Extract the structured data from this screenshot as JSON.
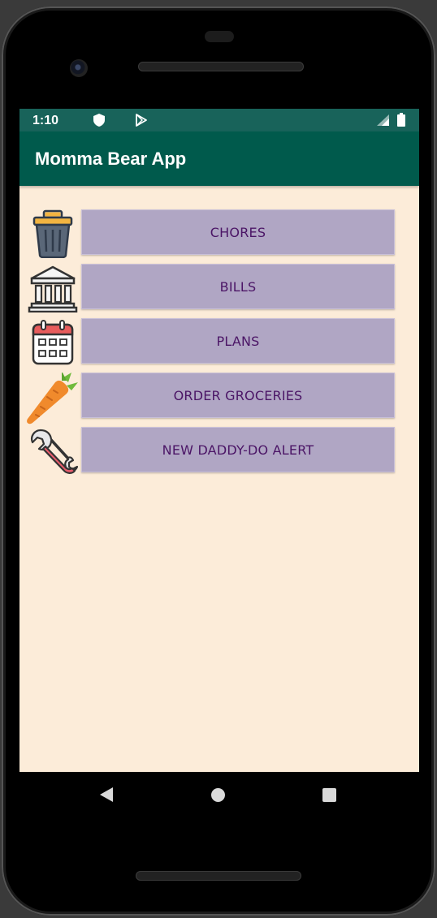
{
  "statusbar": {
    "time": "1:10",
    "icons": [
      "shield-icon",
      "play-store-icon",
      "signal-icon",
      "battery-icon"
    ]
  },
  "appbar": {
    "title": "Momma Bear App"
  },
  "menu": {
    "items": [
      {
        "label": "CHORES",
        "icon": "trash-can-icon"
      },
      {
        "label": "BILLS",
        "icon": "bank-icon"
      },
      {
        "label": "PLANS",
        "icon": "calendar-icon"
      },
      {
        "label": "ORDER GROCERIES",
        "icon": "carrot-icon"
      },
      {
        "label": "NEW DADDY-DO ALERT",
        "icon": "wrench-icon"
      }
    ]
  },
  "navbar": {
    "icons": [
      "back-icon",
      "home-icon",
      "recents-icon"
    ]
  },
  "colors": {
    "statusbar": "#18635a",
    "appbar": "#005a4c",
    "background": "#fcecd9",
    "button": "#b0a6c4",
    "button_text": "#4b1566"
  }
}
